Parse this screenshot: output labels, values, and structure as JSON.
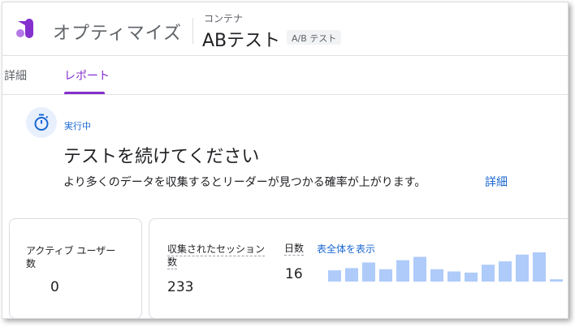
{
  "header": {
    "app_name": "オプティマイズ",
    "container_label": "コンテナ",
    "container_name": "ABテスト",
    "experiment_type": "A/B テスト"
  },
  "tabs": [
    {
      "label": "詳細",
      "active": false
    },
    {
      "label": "レポート",
      "active": true
    }
  ],
  "status": {
    "badge": "実行中",
    "headline": "テストを続けてください",
    "subtext": "より多くのデータを収集するとリーダーが見つかる確率が上がります。",
    "learn_more": "詳細"
  },
  "metrics": {
    "active_users": {
      "label": "アクティブ ユーザー数",
      "value": "0"
    },
    "sessions": {
      "label": "収集されたセッション数",
      "value": "233"
    },
    "days": {
      "label": "日数",
      "value": "16"
    },
    "show_all": "表全体を表示"
  },
  "sessions_by_day": [
    10,
    12,
    17,
    11,
    19,
    22,
    11,
    9,
    8,
    15,
    18,
    24,
    26,
    2
  ],
  "colors": {
    "accent_purple": "#8430ce",
    "link_blue": "#1967d2",
    "bar_blue": "#aecbfa"
  }
}
